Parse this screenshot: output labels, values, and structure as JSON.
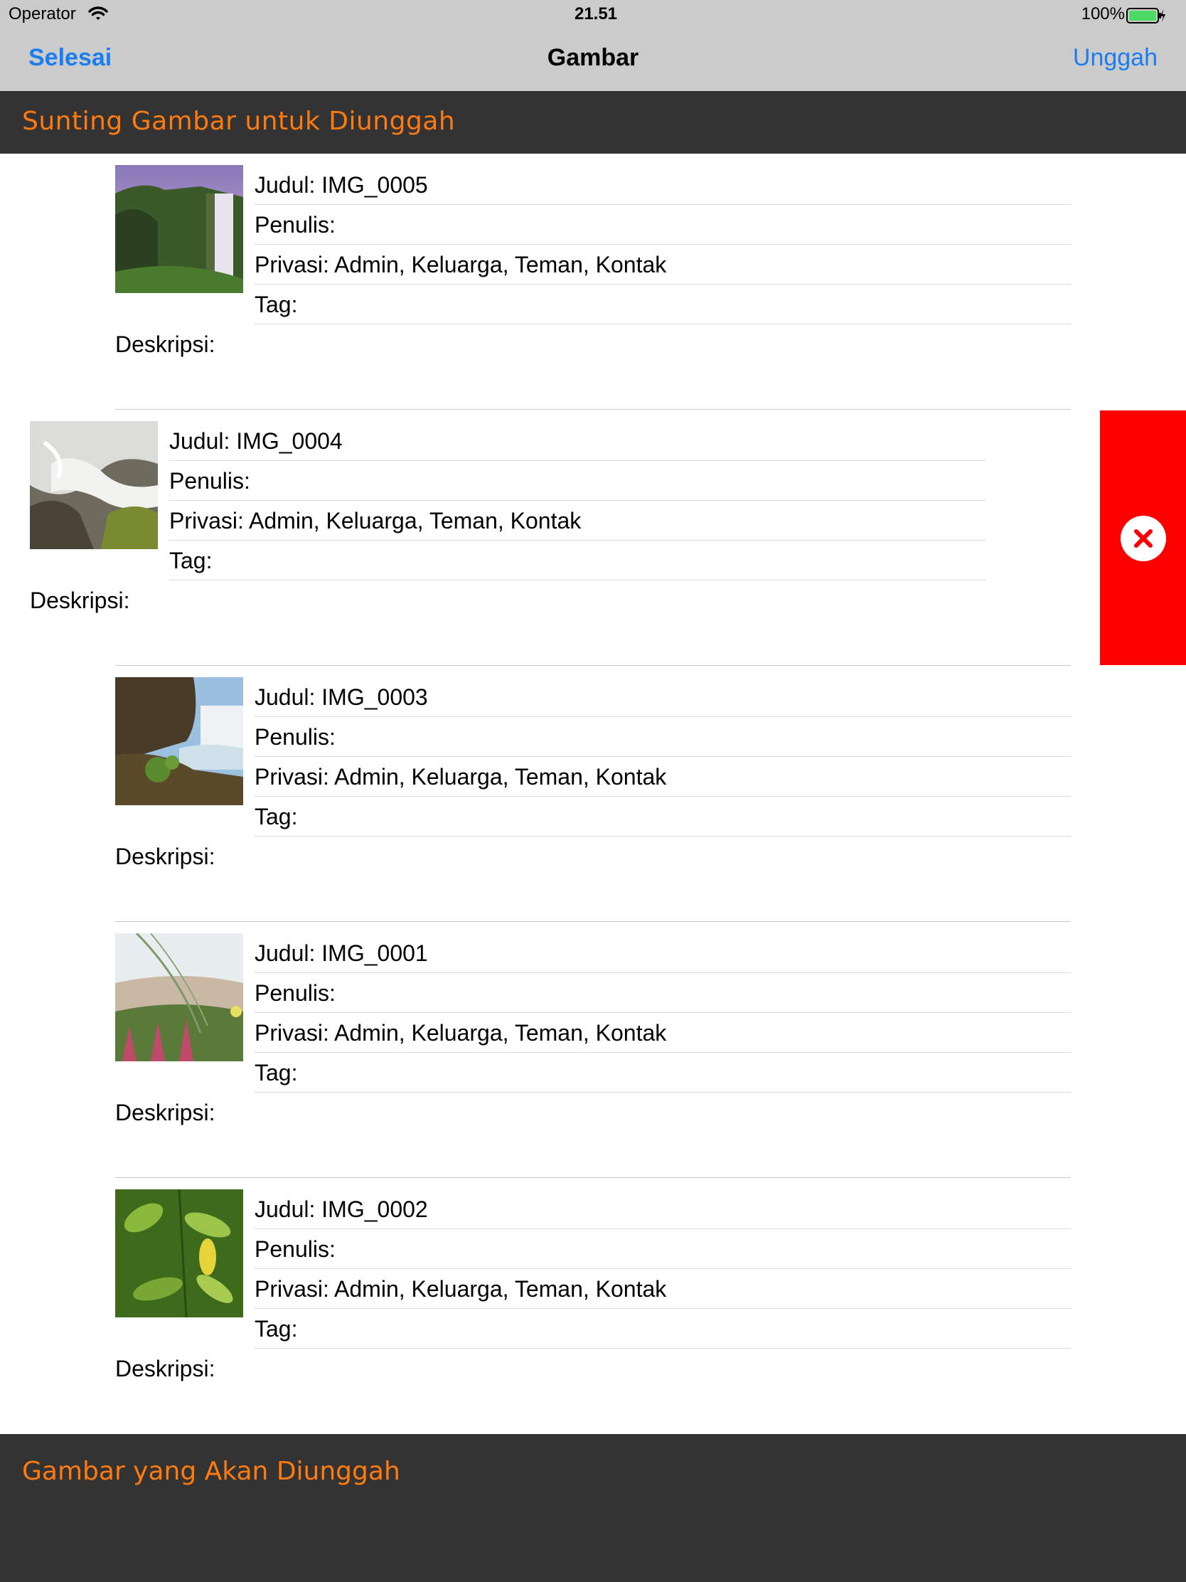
{
  "status_bar": {
    "carrier": "Operator",
    "time": "21.51",
    "battery": "100%"
  },
  "nav": {
    "left_button": "Selesai",
    "title": "Gambar",
    "right_button": "Unggah"
  },
  "edit_section": {
    "title": "Sunting Gambar untuk Diunggah"
  },
  "upload_section": {
    "title": "Gambar yang Akan Diunggah"
  },
  "images": [
    {
      "title_label": "Judul: IMG_0005",
      "author_label": "Penulis:",
      "privacy_label": "Privasi: Admin, Keluarga, Teman, Kontak",
      "tag_label": "Tag:",
      "description_label": "Deskripsi:"
    },
    {
      "title_label": "Judul: IMG_0004",
      "author_label": "Penulis:",
      "privacy_label": "Privasi: Admin, Keluarga, Teman, Kontak",
      "tag_label": "Tag:",
      "description_label": "Deskripsi:"
    },
    {
      "title_label": "Judul: IMG_0003",
      "author_label": "Penulis:",
      "privacy_label": "Privasi: Admin, Keluarga, Teman, Kontak",
      "tag_label": "Tag:",
      "description_label": "Deskripsi:"
    },
    {
      "title_label": "Judul: IMG_0001",
      "author_label": "Penulis:",
      "privacy_label": "Privasi: Admin, Keluarga, Teman, Kontak",
      "tag_label": "Tag:",
      "description_label": "Deskripsi:"
    },
    {
      "title_label": "Judul: IMG_0002",
      "author_label": "Penulis:",
      "privacy_label": "Privasi: Admin, Keluarga, Teman, Kontak",
      "tag_label": "Tag:",
      "description_label": "Deskripsi:"
    }
  ],
  "swipe_action": {
    "icon": "close-icon",
    "color": "#ff0000"
  },
  "colors": {
    "accent_blue": "#1a7ef0",
    "header_orange": "#ff7b10",
    "header_bg": "#333333",
    "bar_bg": "#cbcbcb"
  }
}
